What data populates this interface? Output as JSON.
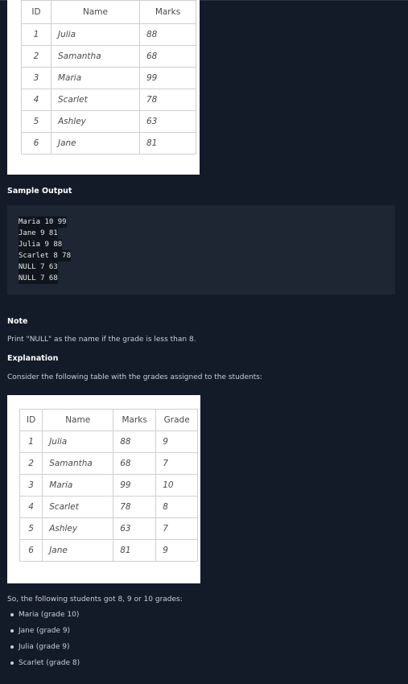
{
  "table1": {
    "headers": [
      "ID",
      "Name",
      "Marks"
    ],
    "rows": [
      [
        "1",
        "Julia",
        "88"
      ],
      [
        "2",
        "Samantha",
        "68"
      ],
      [
        "3",
        "Maria",
        "99"
      ],
      [
        "4",
        "Scarlet",
        "78"
      ],
      [
        "5",
        "Ashley",
        "63"
      ],
      [
        "6",
        "Jane",
        "81"
      ]
    ]
  },
  "sample_output": {
    "heading": "Sample Output",
    "lines": [
      "Maria 10 99",
      "Jane 9 81",
      "Julia 9 88",
      "Scarlet 8 78",
      "NULL 7 63",
      "NULL 7 68"
    ]
  },
  "note": {
    "heading": "Note",
    "text": "Print \"NULL\"  as the name if the grade is less than 8."
  },
  "explanation": {
    "heading": "Explanation",
    "text": "Consider the following table with the grades assigned to the students:"
  },
  "table2": {
    "headers": [
      "ID",
      "Name",
      "Marks",
      "Grade"
    ],
    "rows": [
      [
        "1",
        "Julia",
        "88",
        "9"
      ],
      [
        "2",
        "Samantha",
        "68",
        "7"
      ],
      [
        "3",
        "Maria",
        "99",
        "10"
      ],
      [
        "4",
        "Scarlet",
        "78",
        "8"
      ],
      [
        "5",
        "Ashley",
        "63",
        "7"
      ],
      [
        "6",
        "Jane",
        "81",
        "9"
      ]
    ]
  },
  "summary": {
    "text": "So, the following students got 8, 9 or 10 grades:",
    "items": [
      "Maria (grade 10)",
      "Jane (grade 9)",
      "Julia (grade 9)",
      "Scarlet (grade 8)"
    ]
  }
}
